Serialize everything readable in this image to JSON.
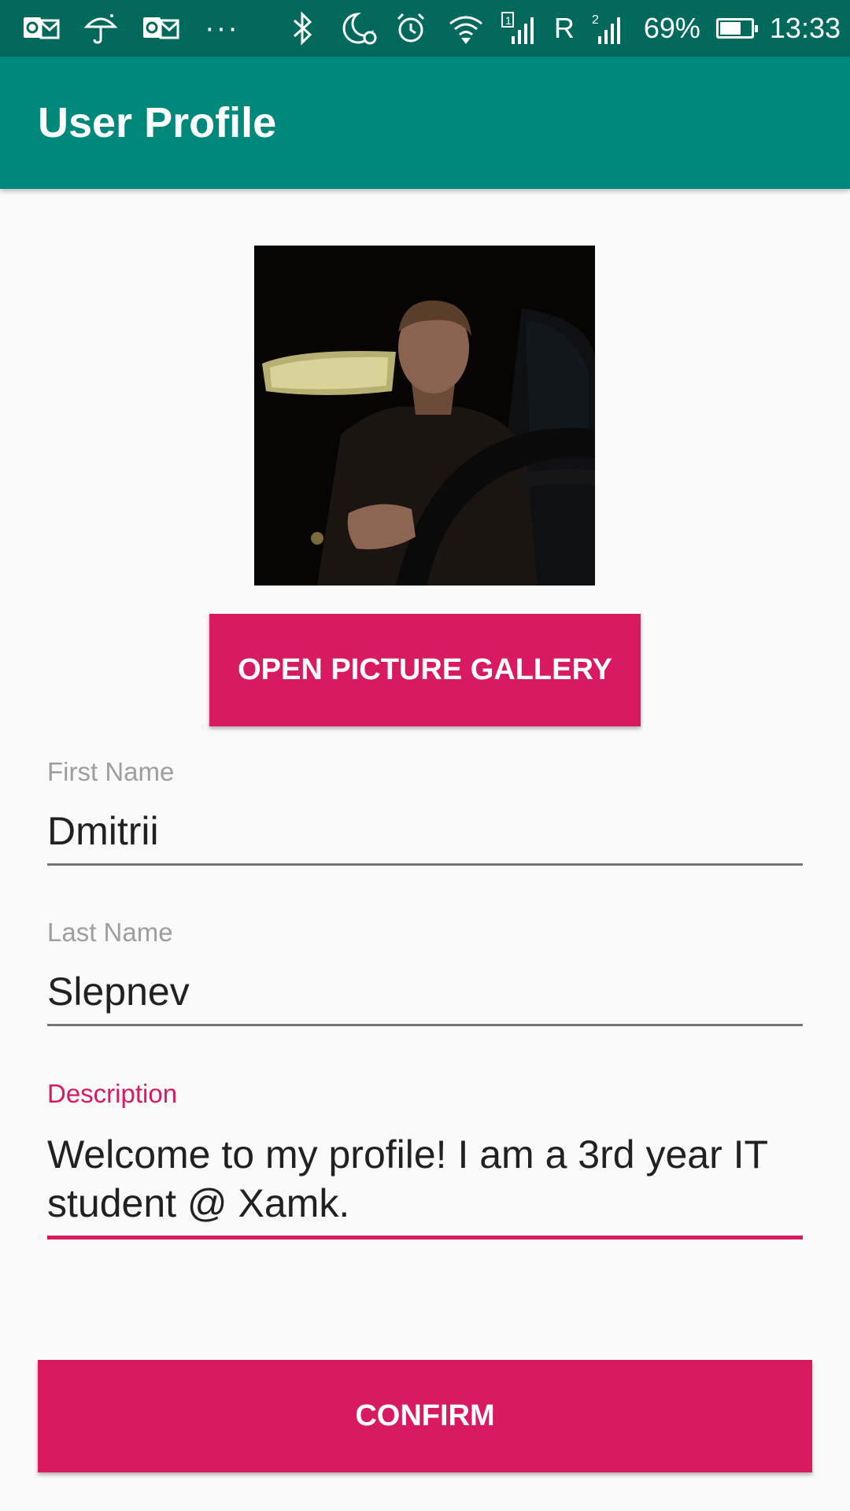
{
  "status_bar": {
    "icons_left": [
      "outlook-icon",
      "umbrella-icon",
      "outlook-icon"
    ],
    "overflow": "···",
    "icons_right": [
      "bluetooth-icon",
      "do-not-disturb-alarm-icon",
      "alarm-icon",
      "wifi-icon",
      "signal-sim1-icon"
    ],
    "roaming": "R",
    "sim2_label": "2",
    "battery_percent": "69%",
    "battery_level": 0.69,
    "time": "13:33"
  },
  "app_bar": {
    "title": "User Profile",
    "color": "#00897b",
    "status_color": "#00695c"
  },
  "profile": {
    "photo_description_icon": "user-photo",
    "gallery_button_label": "OPEN PICTURE GALLERY",
    "accent_color": "#d81b60"
  },
  "form": {
    "first_name": {
      "label": "First Name",
      "value": "Dmitrii"
    },
    "last_name": {
      "label": "Last Name",
      "value": "Slepnev"
    },
    "description": {
      "label": "Description",
      "value": "Welcome to my profile! I am a 3rd year IT student @ Xamk."
    }
  },
  "actions": {
    "confirm_label": "CONFIRM"
  }
}
